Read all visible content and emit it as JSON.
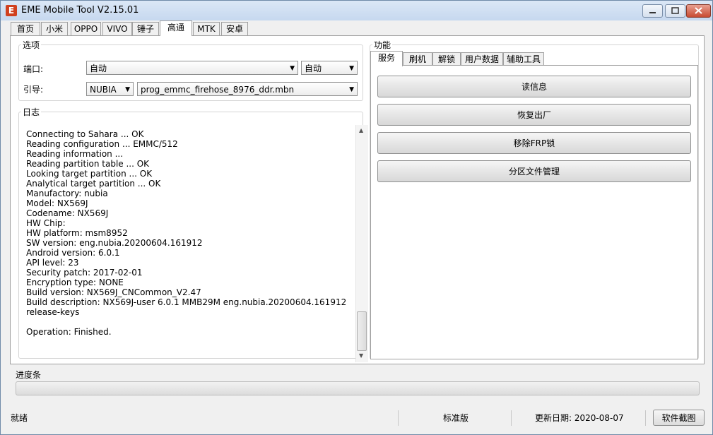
{
  "window": {
    "title": "EME Mobile Tool V2.15.01",
    "icon": "E"
  },
  "top_tabs": [
    "首页",
    "小米",
    "OPPO",
    "VIVO",
    "锤子",
    "高通",
    "MTK",
    "安卓"
  ],
  "active_top_tab": "高通",
  "options": {
    "legend": "选项",
    "port_label": "端口:",
    "port_value": "自动",
    "port_mode_value": "自动",
    "boot_label": "引导:",
    "brand_value": "NUBIA",
    "loader_value": "prog_emmc_firehose_8976_ddr.mbn"
  },
  "log": {
    "legend": "日志",
    "lines": [
      "Connecting to Sahara ... OK",
      "Reading configuration ... EMMC/512",
      "Reading information ...",
      "Reading partition table ... OK",
      "Looking target partition ... OK",
      "Analytical target partition ... OK",
      "Manufactory: nubia",
      "Model: NX569J",
      "Codename: NX569J",
      "HW Chip:",
      "HW platform: msm8952",
      "SW version: eng.nubia.20200604.161912",
      "Android version: 6.0.1",
      "API level: 23",
      "Security patch: 2017-02-01",
      "Encryption type: NONE",
      "Build version: NX569J_CNCommon_V2.47",
      "Build description: NX569J-user 6.0.1 MMB29M eng.nubia.20200604.161912",
      "release-keys",
      "",
      "Operation: Finished."
    ]
  },
  "functions": {
    "legend": "功能",
    "tabs": [
      "服务",
      "刷机",
      "解锁",
      "用户数据",
      "辅助工具"
    ],
    "active_tab": "服务",
    "buttons": [
      "读信息",
      "恢复出厂",
      "移除FRP锁",
      "分区文件管理"
    ]
  },
  "progress": {
    "label": "进度条",
    "value": 0
  },
  "status": {
    "state": "就绪",
    "edition": "标准版",
    "update_date": "更新日期: 2020-08-07",
    "screenshot_button": "软件截图"
  }
}
